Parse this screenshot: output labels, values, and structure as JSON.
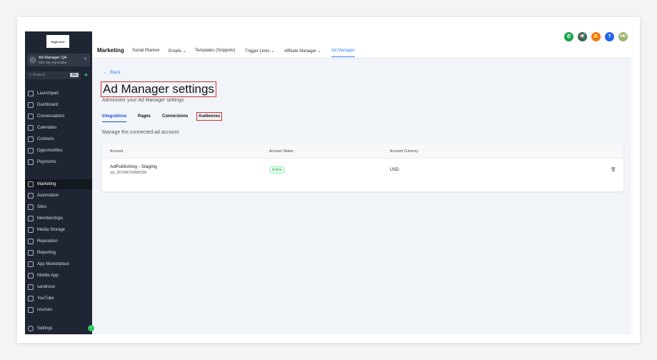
{
  "sidebar": {
    "logo": "HighLevel",
    "account_name": "Ad Manager QA",
    "account_location": "fake city, Karnataka",
    "search_placeholder": "Search",
    "search_shortcut": "⌘K",
    "items": [
      {
        "label": "Launchpad"
      },
      {
        "label": "Dashboard"
      },
      {
        "label": "Conversations"
      },
      {
        "label": "Calendars"
      },
      {
        "label": "Contacts"
      },
      {
        "label": "Opportunities"
      },
      {
        "label": "Payments"
      }
    ],
    "items2": [
      {
        "label": "Marketing"
      },
      {
        "label": "Automation"
      },
      {
        "label": "Sites"
      },
      {
        "label": "Memberships"
      },
      {
        "label": "Media Storage"
      },
      {
        "label": "Reputation"
      },
      {
        "label": "Reporting"
      },
      {
        "label": "App Marketplace"
      },
      {
        "label": "Mobile App"
      },
      {
        "label": "sandrooo"
      },
      {
        "label": "YouTube"
      },
      {
        "label": "courses"
      }
    ],
    "settings": "Settings"
  },
  "header": {
    "title": "Marketing",
    "nav": [
      "Social Planner",
      "Emails",
      "Templates (Snippets)",
      "Trigger Links",
      "Affiliate Manager",
      "Ad Manager"
    ],
    "avatar": "MD"
  },
  "page": {
    "back": "Back",
    "title": "Ad Manager settings",
    "subtitle": "Administer your Ad Manager settings",
    "tabs": [
      "Integrations",
      "Pages",
      "Conversions",
      "Audiences"
    ],
    "section": "Manage the connected ad account"
  },
  "table": {
    "headers": [
      "Account",
      "Account Status",
      "Account Currency"
    ],
    "rows": [
      {
        "name": "AdPublishing - Staging",
        "id": "act_357046700589338",
        "status": "Active",
        "currency": "USD"
      }
    ]
  },
  "colors": {
    "accent": "#3b82f6",
    "sidebar": "#1f2633"
  }
}
